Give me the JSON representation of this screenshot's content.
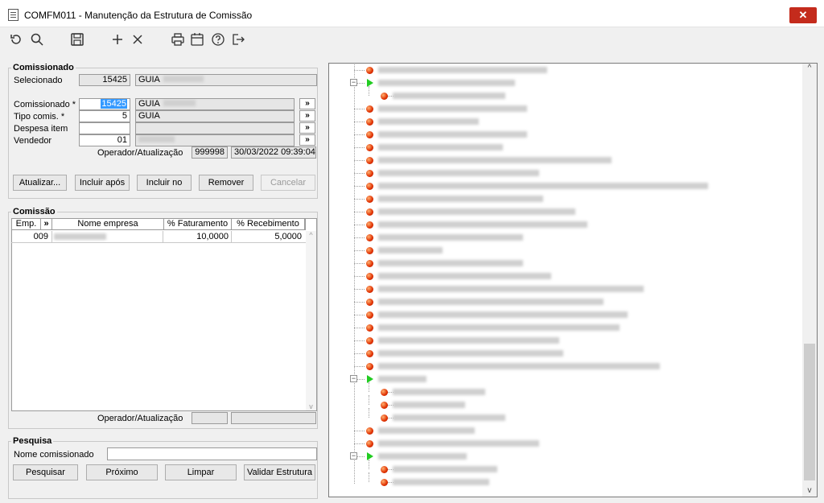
{
  "window": {
    "title": "COMFM011 - Manutenção da Estrutura de Comissão",
    "close_label": "✕"
  },
  "toolbar": {
    "icons": [
      "refresh-icon",
      "search-icon",
      "save-icon",
      "add-icon",
      "delete-icon",
      "print-icon",
      "calendar-icon",
      "help-icon",
      "exit-icon"
    ]
  },
  "comissionado": {
    "group_title": "Comissionado",
    "selecionado_label": "Selecionado",
    "selecionado_code": "15425",
    "selecionado_name": "GUIA",
    "comissionado_label": "Comissionado *",
    "comissionado_code": "15425",
    "comissionado_name": "GUIA",
    "tipo_label": "Tipo comis. *",
    "tipo_value": "5",
    "tipo_name": "GUIA",
    "despesa_label": "Despesa item",
    "despesa_value": "",
    "vendedor_label": "Vendedor",
    "vendedor_value": "01",
    "lookup_label": "»",
    "operador_label": "Operador/Atualização",
    "operador_value": "999998",
    "atualizacao_value": "30/03/2022 09:39:04",
    "buttons": {
      "atualizar": "Atualizar...",
      "incluir_apos": "Incluir após",
      "incluir_no": "Incluir no",
      "remover": "Remover",
      "cancelar": "Cancelar"
    }
  },
  "comissao": {
    "group_title": "Comissão",
    "columns": [
      "Emp.",
      "»",
      "Nome empresa",
      "% Faturamento",
      "% Recebimento"
    ],
    "rows": [
      {
        "emp": "009",
        "nome": "",
        "faturamento": "10,0000",
        "recebimento": "5,0000"
      }
    ],
    "scroll_up": "^",
    "scroll_down": "v",
    "operador_label": "Operador/Atualização",
    "operador_value": "",
    "atualizacao_value": ""
  },
  "pesquisa": {
    "group_title": "Pesquisa",
    "nome_label": "Nome comissionado",
    "nome_value": "",
    "buttons": {
      "pesquisar": "Pesquisar",
      "proximo": "Próximo",
      "limpar": "Limpar",
      "validar": "Validar Estrutura"
    }
  },
  "tree": {
    "expander_label": "−",
    "scroll_up": "^",
    "scroll_down": "v"
  },
  "colors": {
    "close_red": "#c42b1c",
    "selection_blue": "#3399ff",
    "node_red": "#e03000",
    "node_green": "#22cc22"
  }
}
